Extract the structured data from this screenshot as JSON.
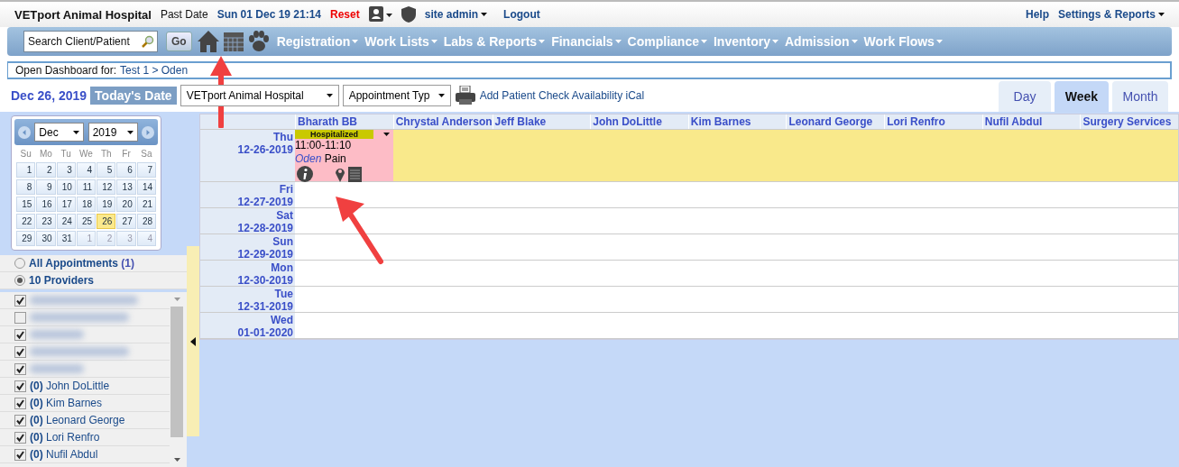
{
  "top_bar": {
    "app_name": "VETport Animal Hospital",
    "past_date_label": "Past Date",
    "date_time": "Sun 01 Dec 19 21:14",
    "reset": "Reset",
    "user": "site admin",
    "logout": "Logout",
    "help": "Help",
    "settings": "Settings & Reports"
  },
  "nav": {
    "search": {
      "placeholder": "Search Client/Patient"
    },
    "go": "Go",
    "menus": [
      "Registration",
      "Work Lists",
      "Labs & Reports",
      "Financials",
      "Compliance",
      "Inventory",
      "Admission",
      "Work Flows"
    ]
  },
  "dashboard": {
    "label": "Open Dashboard for:",
    "path": "Test 1 > Oden"
  },
  "toolbar": {
    "date": "Dec 26, 2019",
    "today_button": "Today's Date",
    "location": "VETport Animal Hospital",
    "appointment_type": "Appointment Typ",
    "links": "Add Patient Check Availability iCal"
  },
  "view_tabs": [
    {
      "label": "Day",
      "selected": false
    },
    {
      "label": "Week",
      "selected": true
    },
    {
      "label": "Month",
      "selected": false
    }
  ],
  "mini_calendar": {
    "month": "Dec",
    "year": "2019",
    "weekdays": [
      "Su",
      "Mo",
      "Tu",
      "We",
      "Th",
      "Fr",
      "Sa"
    ],
    "weeks": [
      [
        {
          "day": "1",
          "selected": false,
          "other_month": false
        },
        {
          "day": "2",
          "selected": false,
          "other_month": false
        },
        {
          "day": "3",
          "selected": false,
          "other_month": false
        },
        {
          "day": "4",
          "selected": false,
          "other_month": false
        },
        {
          "day": "5",
          "selected": false,
          "other_month": false
        },
        {
          "day": "6",
          "selected": false,
          "other_month": false
        },
        {
          "day": "7",
          "selected": false,
          "other_month": false
        }
      ],
      [
        {
          "day": "8",
          "selected": false,
          "other_month": false
        },
        {
          "day": "9",
          "selected": false,
          "other_month": false
        },
        {
          "day": "10",
          "selected": false,
          "other_month": false
        },
        {
          "day": "11",
          "selected": false,
          "other_month": false
        },
        {
          "day": "12",
          "selected": false,
          "other_month": false
        },
        {
          "day": "13",
          "selected": false,
          "other_month": false
        },
        {
          "day": "14",
          "selected": false,
          "other_month": false
        }
      ],
      [
        {
          "day": "15",
          "selected": false,
          "other_month": false
        },
        {
          "day": "16",
          "selected": false,
          "other_month": false
        },
        {
          "day": "17",
          "selected": false,
          "other_month": false
        },
        {
          "day": "18",
          "selected": false,
          "other_month": false
        },
        {
          "day": "19",
          "selected": false,
          "other_month": false
        },
        {
          "day": "20",
          "selected": false,
          "other_month": false
        },
        {
          "day": "21",
          "selected": false,
          "other_month": false
        }
      ],
      [
        {
          "day": "22",
          "selected": false,
          "other_month": false
        },
        {
          "day": "23",
          "selected": false,
          "other_month": false
        },
        {
          "day": "24",
          "selected": false,
          "other_month": false
        },
        {
          "day": "25",
          "selected": false,
          "other_month": false
        },
        {
          "day": "26",
          "selected": true,
          "other_month": false
        },
        {
          "day": "27",
          "selected": false,
          "other_month": false
        },
        {
          "day": "28",
          "selected": false,
          "other_month": false
        }
      ],
      [
        {
          "day": "29",
          "selected": false,
          "other_month": false
        },
        {
          "day": "30",
          "selected": false,
          "other_month": false
        },
        {
          "day": "31",
          "selected": false,
          "other_month": false
        },
        {
          "day": "1",
          "selected": false,
          "other_month": true
        },
        {
          "day": "2",
          "selected": false,
          "other_month": true
        },
        {
          "day": "3",
          "selected": false,
          "other_month": true
        },
        {
          "day": "4",
          "selected": false,
          "other_month": true
        }
      ]
    ]
  },
  "filters": [
    {
      "label": "All Appointments",
      "count": "(1)",
      "selected": false
    },
    {
      "label": "10 Providers",
      "selected": true
    }
  ],
  "providers": [
    {
      "kind": "blurred",
      "checked": true
    },
    {
      "kind": "blurred",
      "checked": false
    },
    {
      "kind": "blurred",
      "checked": true
    },
    {
      "kind": "blurred",
      "checked": true
    },
    {
      "kind": "blurred",
      "checked": true
    },
    {
      "kind": "provider",
      "count": "(0)",
      "name": "John DoLittle",
      "checked": true
    },
    {
      "kind": "provider",
      "count": "(0)",
      "name": "Kim Barnes",
      "checked": true
    },
    {
      "kind": "provider",
      "count": "(0)",
      "name": "Leonard George",
      "checked": true
    },
    {
      "kind": "provider",
      "count": "(0)",
      "name": "Lori Renfro",
      "checked": true
    },
    {
      "kind": "provider",
      "count": "(0)",
      "name": "Nufil Abdul",
      "checked": true
    }
  ],
  "schedule": {
    "columns": [
      "Bharath BB",
      "Chrystal Anderson",
      "Jeff Blake",
      "John DoLittle",
      "Kim Barnes",
      "Leonard George",
      "Lori Renfro",
      "Nufil Abdul",
      "Surgery Services"
    ],
    "days": [
      {
        "weekday": "Thu",
        "date": "12-26-2019",
        "today": true,
        "appointments": [
          {
            "status": "Hospitalized",
            "time": "11:00-11:10",
            "patient": "Oden",
            "reason": "Pain"
          }
        ]
      },
      {
        "weekday": "Fri",
        "date": "12-27-2019",
        "today": false
      },
      {
        "weekday": "Sat",
        "date": "12-28-2019",
        "today": false
      },
      {
        "weekday": "Sun",
        "date": "12-29-2019",
        "today": false
      },
      {
        "weekday": "Mon",
        "date": "12-30-2019",
        "today": false
      },
      {
        "weekday": "Tue",
        "date": "12-31-2019",
        "today": false
      },
      {
        "weekday": "Wed",
        "date": "01-01-2020",
        "today": false
      }
    ]
  }
}
